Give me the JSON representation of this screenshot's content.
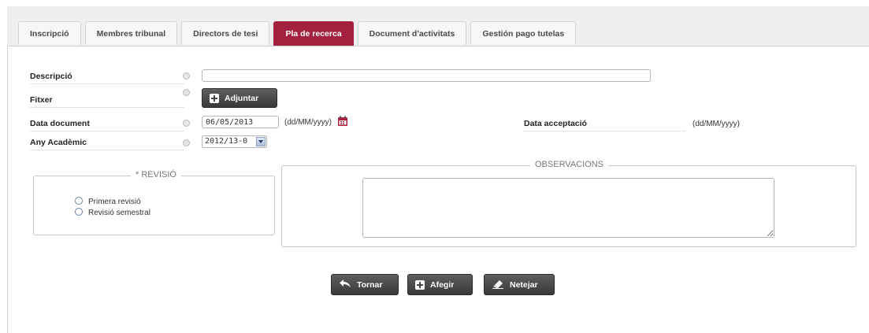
{
  "tabs": [
    {
      "label": "Inscripció",
      "active": false
    },
    {
      "label": "Membres tribunal",
      "active": false
    },
    {
      "label": "Directors de tesi",
      "active": false
    },
    {
      "label": "Pla de recerca",
      "active": true
    },
    {
      "label": "Document d'activitats",
      "active": false
    },
    {
      "label": "Gestión pago tutelas",
      "active": false
    }
  ],
  "form": {
    "descripcio_label": "Descripció",
    "descripcio_value": "",
    "fitxer_label": "Fitxer",
    "adjuntar_label": "Adjuntar",
    "data_document_label": "Data document",
    "data_document_value": "06/05/2013",
    "date_format_hint": "(dd/MM/yyyy)",
    "data_acceptacio_label": "Data acceptació",
    "data_acceptacio_hint": "(dd/MM/yyyy)",
    "any_academic_label": "Any Acadèmic",
    "any_academic_value": "2012/13-0"
  },
  "revisio": {
    "legend": "* REVISIÓ",
    "options": [
      "Primera revisió",
      "Revisió semestral"
    ]
  },
  "observacions": {
    "legend": "OBSERVACIONS",
    "value": ""
  },
  "actions": {
    "tornar": "Tornar",
    "afegir": "Afegir",
    "netejar": "Netejar"
  },
  "colors": {
    "active_tab": "#a3213e",
    "button_dark": "#3d3d3d",
    "calendar_icon": "#b0203c"
  }
}
